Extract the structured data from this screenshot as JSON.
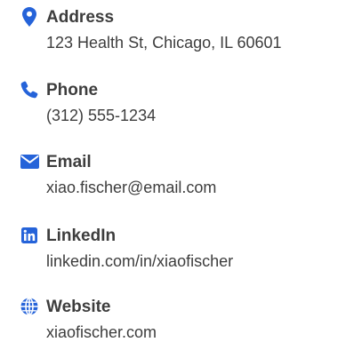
{
  "accent_color": "#2563d9",
  "text_color": "#3d3d3d",
  "contacts": [
    {
      "icon": "map-pin-icon",
      "label": "Address",
      "value": "123 Health St, Chicago, IL 60601"
    },
    {
      "icon": "phone-icon",
      "label": "Phone",
      "value": "(312) 555-1234"
    },
    {
      "icon": "envelope-icon",
      "label": "Email",
      "value": "xiao.fischer@email.com"
    },
    {
      "icon": "linkedin-icon",
      "label": "LinkedIn",
      "value": "linkedin.com/in/xiaofischer"
    },
    {
      "icon": "globe-icon",
      "label": "Website",
      "value": "xiaofischer.com"
    }
  ]
}
